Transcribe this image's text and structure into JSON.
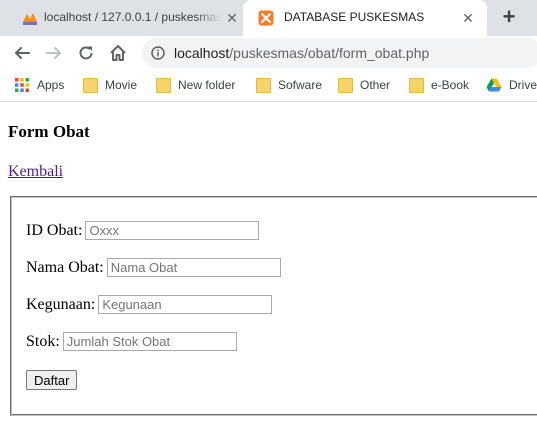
{
  "browser": {
    "tabs": [
      {
        "title": "localhost / 127.0.0.1 / puskesmas",
        "favicon": "phpmyadmin-icon",
        "close": "✕"
      },
      {
        "title": "DATABASE PUSKESMAS",
        "favicon": "xampp-icon",
        "close": "✕"
      }
    ],
    "new_tab": "+",
    "url_host": "localhost",
    "url_path": "/puskesmas/obat/form_obat.php",
    "bookmarks": [
      {
        "label": "Apps",
        "icon": "apps-grid-icon"
      },
      {
        "label": "Movie",
        "icon": "folder-icon"
      },
      {
        "label": "New folder",
        "icon": "folder-icon"
      },
      {
        "label": "Sofware",
        "icon": "folder-icon"
      },
      {
        "label": "Other",
        "icon": "folder-icon"
      },
      {
        "label": "e-Book",
        "icon": "folder-icon"
      },
      {
        "label": "Drive",
        "icon": "google-drive-icon"
      }
    ]
  },
  "page": {
    "heading": "Form Obat",
    "back_link": "Kembali",
    "fields": [
      {
        "label": "ID Obat:",
        "placeholder": "Oxxx",
        "value": ""
      },
      {
        "label": "Nama Obat:",
        "placeholder": "Nama Obat",
        "value": ""
      },
      {
        "label": "Kegunaan:",
        "placeholder": "Kegunaan",
        "value": ""
      },
      {
        "label": "Stok:",
        "placeholder": "Jumlah Stok Obat",
        "value": ""
      }
    ],
    "submit_label": "Daftar"
  },
  "colors": {
    "tab_strip": "#dee1e6",
    "omnibox": "#f1f3f4",
    "link_visited": "#551a8b",
    "xampp_orange": "#fb7a24"
  }
}
